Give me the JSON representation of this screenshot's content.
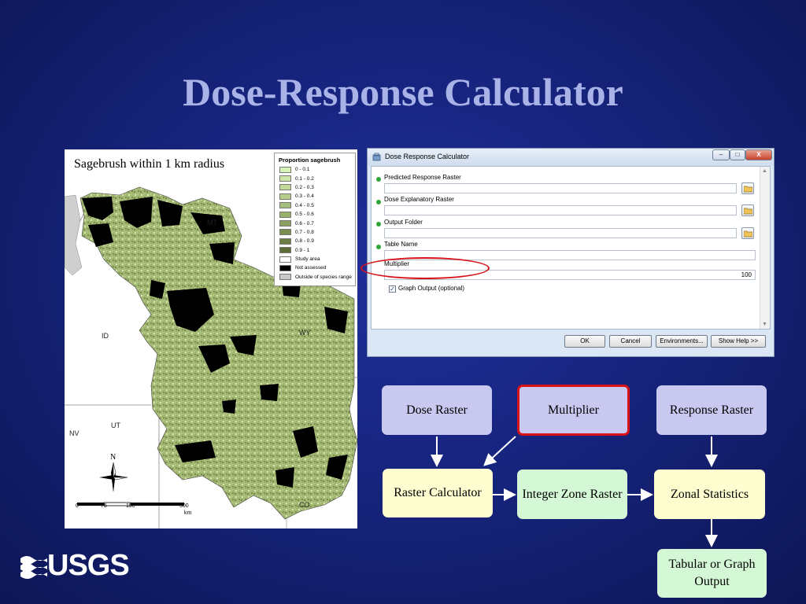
{
  "slide": {
    "title": "Dose-Response Calculator"
  },
  "map": {
    "caption": "Sagebrush within 1 km radius",
    "state_labels": [
      "MT",
      "ID",
      "WY",
      "NV",
      "UT",
      "CO"
    ],
    "legend": {
      "title": "Proportion sagebrush",
      "items": [
        {
          "label": "0 - 0.1",
          "color": "#d9f2b8"
        },
        {
          "label": "0.1 - 0.2",
          "color": "#cde6a8"
        },
        {
          "label": "0.2 - 0.3",
          "color": "#c1da99"
        },
        {
          "label": "0.3 - 0.4",
          "color": "#b4cd8b"
        },
        {
          "label": "0.4 - 0.5",
          "color": "#a6bf7c"
        },
        {
          "label": "0.5 - 0.6",
          "color": "#98b06c"
        },
        {
          "label": "0.6 - 0.7",
          "color": "#89a05e"
        },
        {
          "label": "0.7 - 0.8",
          "color": "#7b904f"
        },
        {
          "label": "0.8 - 0.9",
          "color": "#6c7f42"
        },
        {
          "label": "0.9 - 1",
          "color": "#5b6d34"
        },
        {
          "label": "Study area",
          "color": "#ffffff"
        },
        {
          "label": "Not assessed",
          "color": "#000000"
        },
        {
          "label": "Outside of species range",
          "color": "#c9c9c9"
        }
      ]
    },
    "compass_label": "N",
    "scale": {
      "ticks": [
        "0",
        "75",
        "150",
        "300"
      ],
      "unit": "km"
    }
  },
  "dialog": {
    "title": "Dose Response Calculator",
    "window_buttons": {
      "minimize": "–",
      "maximize": "□",
      "close": "X"
    },
    "params": [
      {
        "label": "Predicted Response Raster",
        "value": "",
        "required": true,
        "browse": true
      },
      {
        "label": "Dose Explanatory Raster",
        "value": "",
        "required": true,
        "browse": true
      },
      {
        "label": "Output Folder",
        "value": "",
        "required": true,
        "browse": true
      },
      {
        "label": "Table Name",
        "value": "",
        "required": true,
        "browse": false
      },
      {
        "label": "Multiplier",
        "value": "100",
        "required": false,
        "browse": false
      }
    ],
    "checkbox": {
      "label": "Graph Output (optional)",
      "checked": true,
      "mark": "✓"
    },
    "buttons": {
      "ok": "OK",
      "cancel": "Cancel",
      "environments": "Environments...",
      "help": "Show Help >>"
    }
  },
  "flow": {
    "dose_raster": "Dose Raster",
    "multiplier": "Multiplier",
    "response_raster": "Response Raster",
    "raster_calculator": "Raster Calculator",
    "integer_zone_raster": "Integer Zone Raster",
    "zonal_statistics": "Zonal Statistics",
    "tabular_output": "Tabular or Graph Output"
  },
  "logo": {
    "text": "USGS"
  }
}
